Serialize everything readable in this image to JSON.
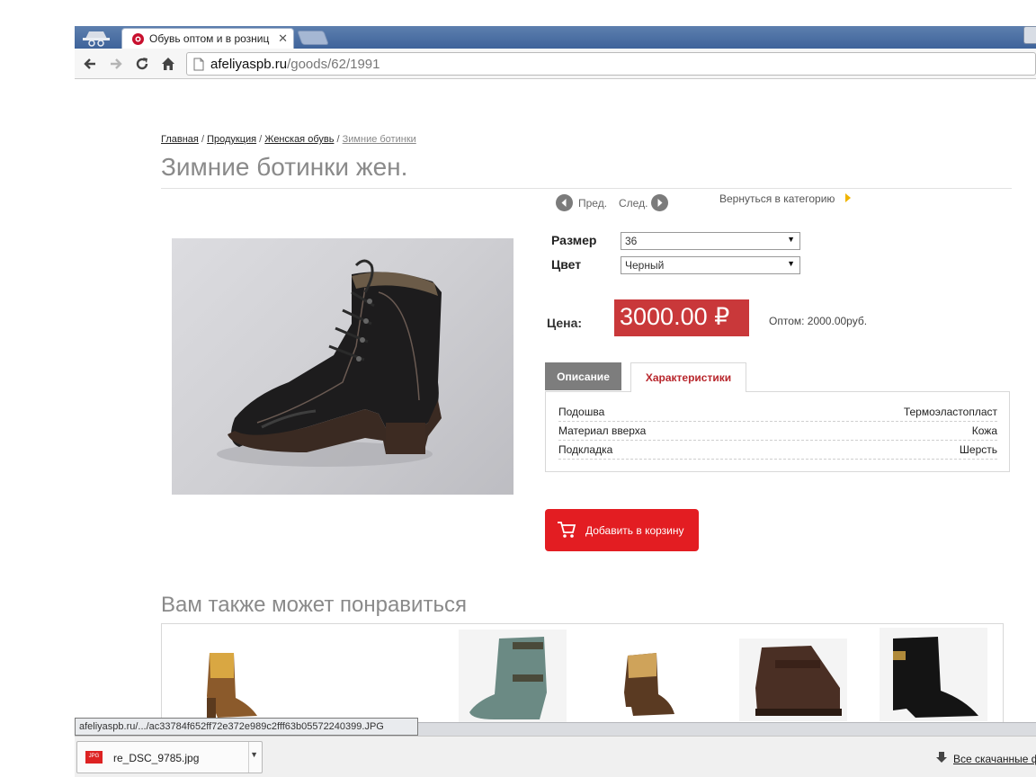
{
  "browser": {
    "tab_title": "Обувь оптом и в розниц",
    "url_host": "afeliyaspb.ru",
    "url_path": "/goods/62/1991",
    "status_url": "afeliyaspb.ru/.../ac33784f652ff72e372e989c2fff63b05572240399.JPG"
  },
  "breadcrumb": [
    {
      "label": "Главная"
    },
    {
      "label": "Продукция"
    },
    {
      "label": "Женская обувь"
    },
    {
      "label": "Зимние ботинки"
    }
  ],
  "page": {
    "title": "Зимние ботинки жен.",
    "prev_label": "Пред.",
    "next_label": "След.",
    "back_label": "Вернуться в категорию"
  },
  "options": {
    "size_label": "Размер",
    "size_value": "36",
    "color_label": "Цвет",
    "color_value": "Черный"
  },
  "price": {
    "label": "Цена:",
    "value": "3000.00 ₽",
    "wholesale": "Оптом: 2000.00руб."
  },
  "tabs": {
    "description": "Описание",
    "specs": "Характеристики"
  },
  "specs": [
    {
      "key": "Подошва",
      "value": "Термоэластопласт"
    },
    {
      "key": "Материал вверха",
      "value": "Кожа"
    },
    {
      "key": "Подкладка",
      "value": "Шерсть"
    }
  ],
  "cart_label": "Добавить в корзину",
  "recommend_title": "Вам также может понравиться",
  "downloads": {
    "file_name": "re_DSC_9785.jpg",
    "file_type": "JPG",
    "all_label": "Все скачанные ф"
  },
  "colors": {
    "price_bg": "#c9383a",
    "cart_bg": "#e31d22",
    "active_tab_text": "#b8262c",
    "inactive_tab_bg": "#7d7d7d"
  }
}
